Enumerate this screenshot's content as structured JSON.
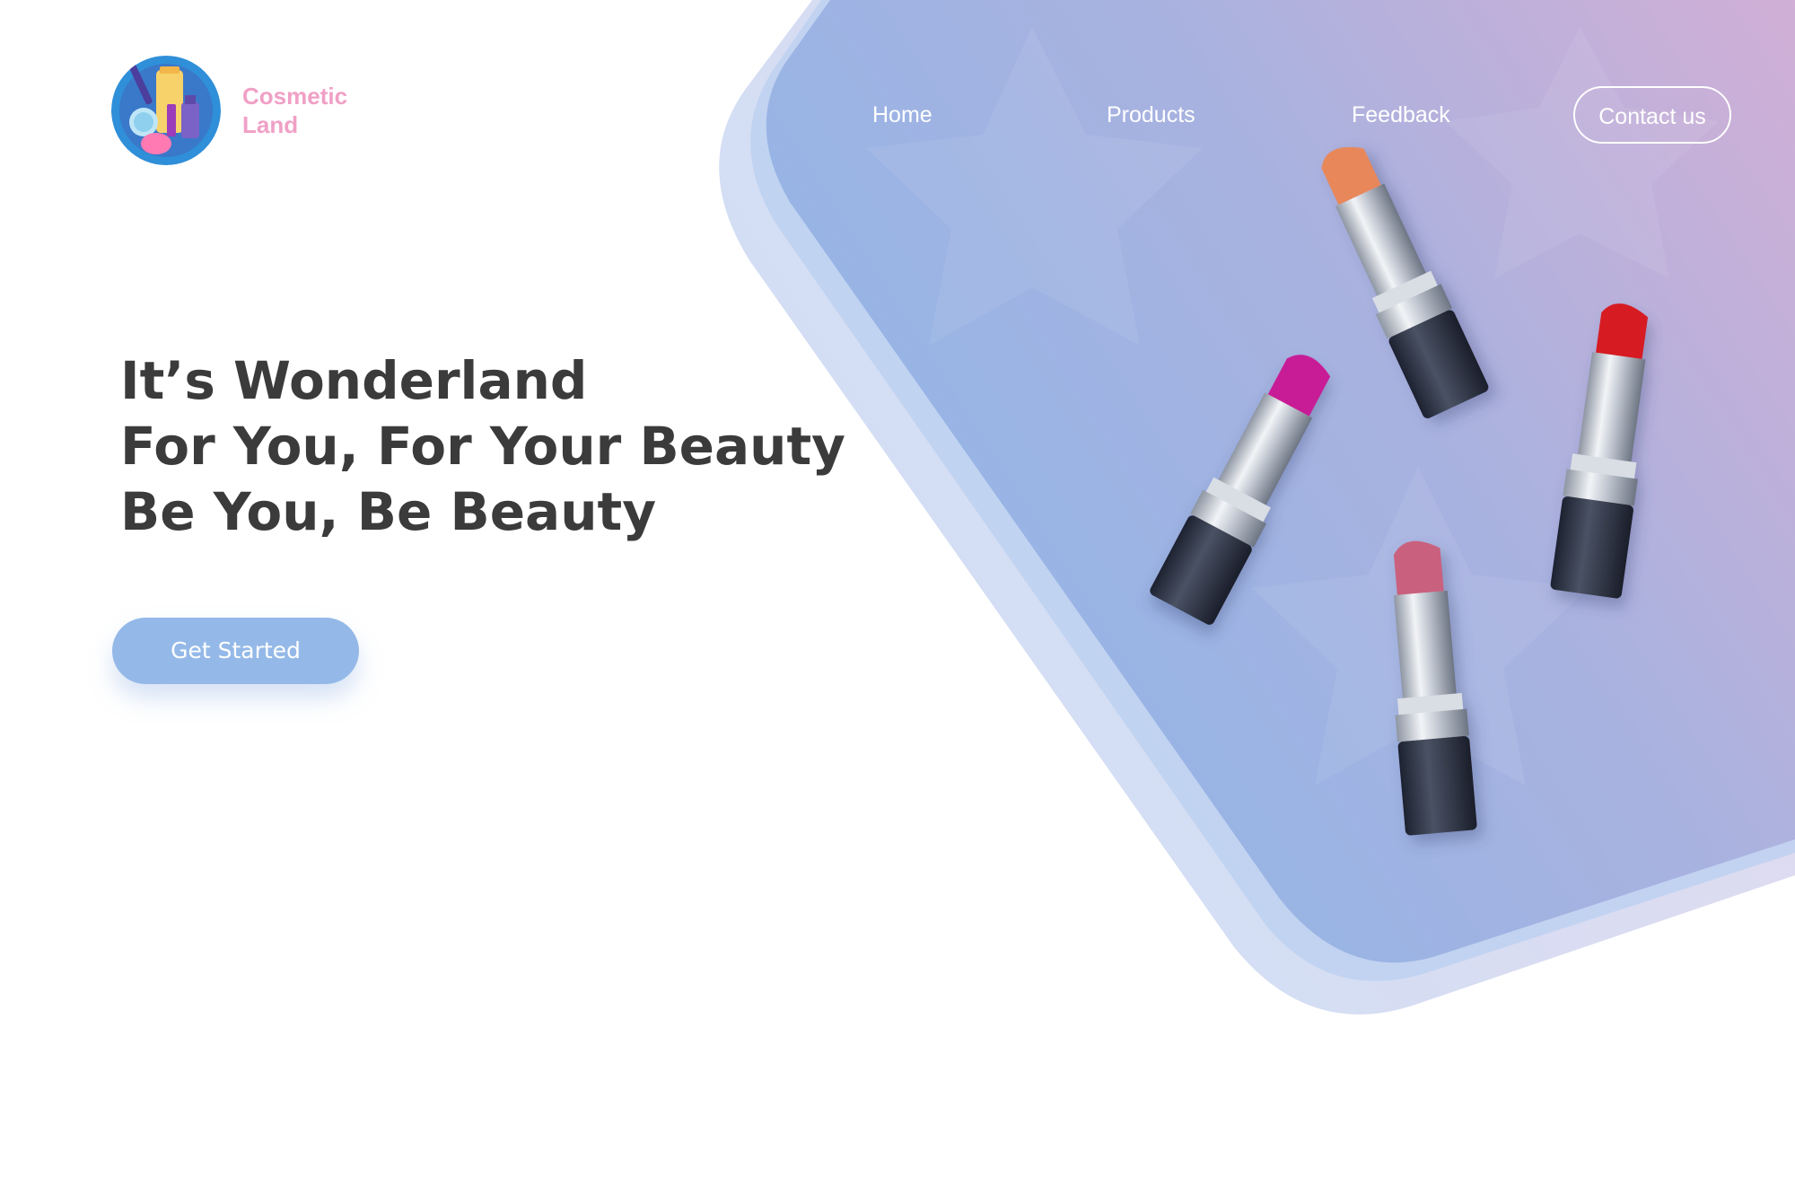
{
  "brand": {
    "name_line1": "Cosmetic",
    "name_line2": "Land",
    "color": "#f0a0c6"
  },
  "nav": {
    "home": "Home",
    "products": "Products",
    "feedback": "Feedback",
    "contact": "Contact us"
  },
  "hero": {
    "line1": "It’s Wonderland",
    "line2": "For You, For Your Beauty",
    "line3": "Be You, Be Beauty",
    "cta": "Get Started"
  },
  "colors": {
    "gradient_start": "#8fb5e8",
    "gradient_end": "#cfb0d6",
    "cta": "#94b9e8",
    "text": "#3b3b3b"
  },
  "lipsticks": [
    {
      "name": "lipstick-orange",
      "color": "#e8875a"
    },
    {
      "name": "lipstick-magenta",
      "color": "#c81b96"
    },
    {
      "name": "lipstick-red",
      "color": "#d61d24"
    },
    {
      "name": "lipstick-pink",
      "color": "#c9607e"
    }
  ],
  "icons": [
    "cosmetics-logo-icon"
  ]
}
